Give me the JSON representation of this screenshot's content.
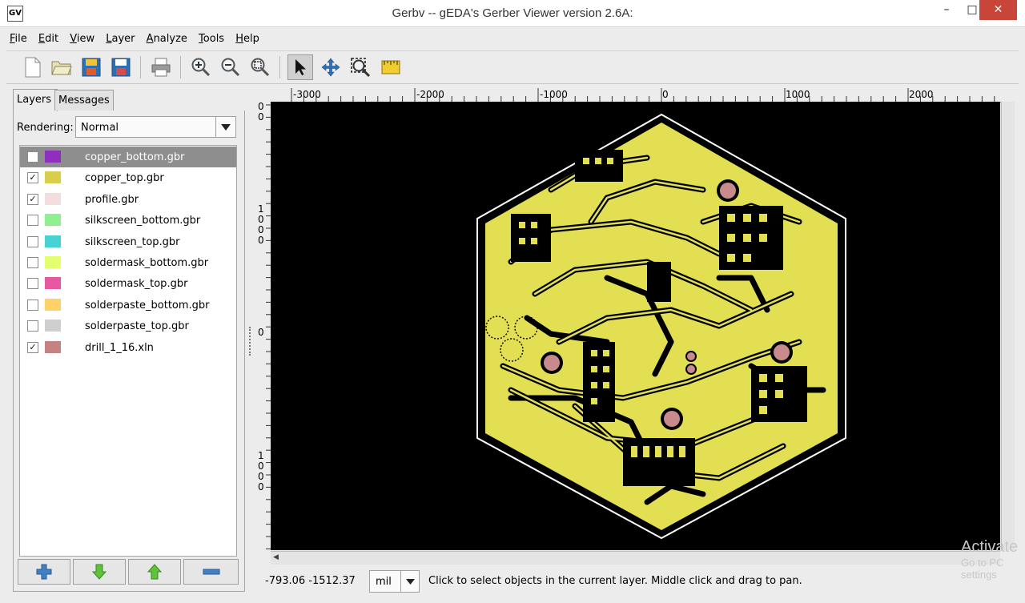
{
  "window": {
    "title": "Gerbv -- gEDA's Gerber Viewer version 2.6A:"
  },
  "menu": [
    {
      "mnemonic": "F",
      "rest": "ile"
    },
    {
      "mnemonic": "E",
      "rest": "dit"
    },
    {
      "mnemonic": "V",
      "rest": "iew"
    },
    {
      "mnemonic": "L",
      "rest": "ayer"
    },
    {
      "mnemonic": "A",
      "rest": "nalyze"
    },
    {
      "mnemonic": "T",
      "rest": "ools"
    },
    {
      "mnemonic": "H",
      "rest": "elp"
    }
  ],
  "toolbar": {
    "active_tool": "pointer-tool"
  },
  "tabs": {
    "layers": "Layers",
    "messages": "Messages"
  },
  "rendering": {
    "label": "Rendering:",
    "value": "Normal"
  },
  "layers": [
    {
      "name": "copper_bottom.gbr",
      "checked": false,
      "color": "#8e2fbf",
      "selected": true
    },
    {
      "name": "copper_top.gbr",
      "checked": true,
      "color": "#d9cd4c",
      "selected": false
    },
    {
      "name": "profile.gbr",
      "checked": true,
      "color": "#f2dede",
      "selected": false
    },
    {
      "name": "silkscreen_bottom.gbr",
      "checked": false,
      "color": "#8ff08f",
      "selected": false
    },
    {
      "name": "silkscreen_top.gbr",
      "checked": false,
      "color": "#47d3d3",
      "selected": false
    },
    {
      "name": "soldermask_bottom.gbr",
      "checked": false,
      "color": "#e3ff6e",
      "selected": false
    },
    {
      "name": "soldermask_top.gbr",
      "checked": false,
      "color": "#e8589f",
      "selected": false
    },
    {
      "name": "solderpaste_bottom.gbr",
      "checked": false,
      "color": "#ffd166",
      "selected": false
    },
    {
      "name": "solderpaste_top.gbr",
      "checked": false,
      "color": "#cfcfcf",
      "selected": false
    },
    {
      "name": "drill_1_16.xln",
      "checked": true,
      "color": "#c48282",
      "selected": false
    }
  ],
  "ruler": {
    "h_labels": [
      "-3000",
      "-2000",
      "-1000",
      "0",
      "1000",
      "2000"
    ],
    "v_labels": [
      "0\n0",
      "1\n0\n0\n0",
      "0",
      "1\n0\n0\n0"
    ]
  },
  "status": {
    "coords": "-793.06 -1512.37",
    "unit": "mil",
    "hint": "Click to select objects in the current layer. Middle click and drag to pan."
  },
  "watermark": {
    "line1": "Activate",
    "line2": "Go to PC settings"
  },
  "colors": {
    "board": "#e2df52",
    "background": "#000000",
    "outline": "#ffffff",
    "drill": "#c88a8a"
  }
}
